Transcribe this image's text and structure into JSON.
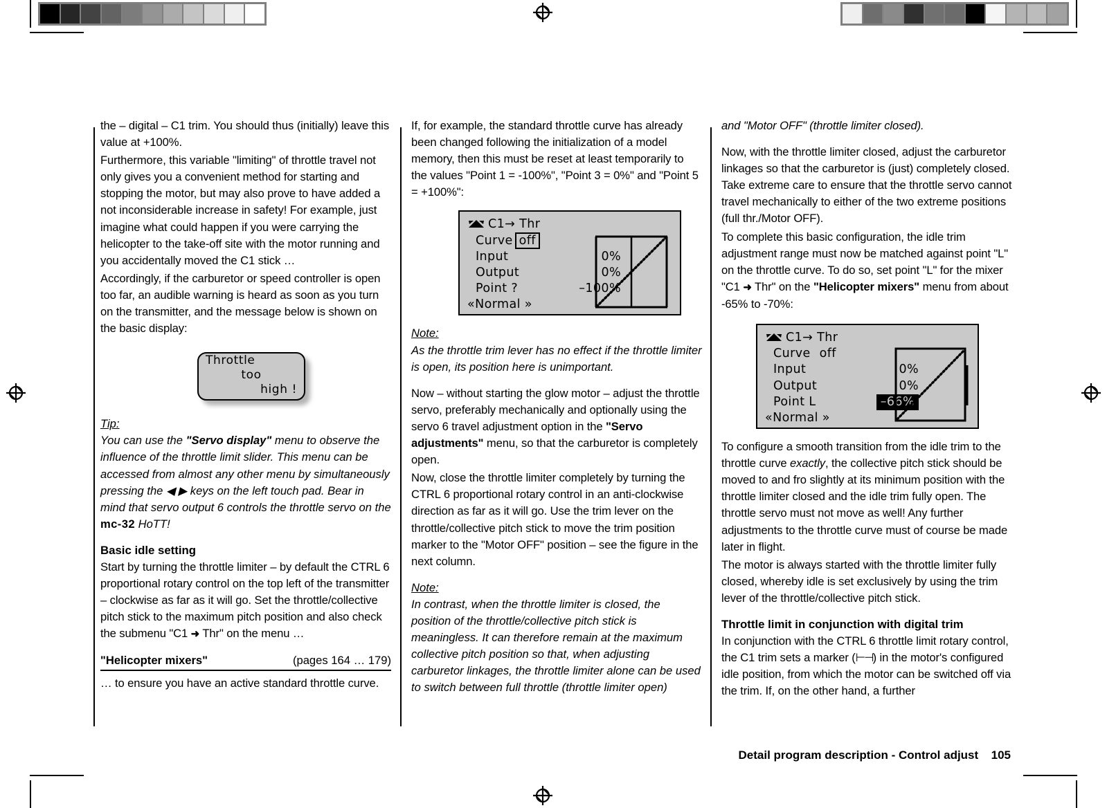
{
  "page": {
    "footer_text": "Detail program description - Control adjust",
    "page_number": "105"
  },
  "calibration": {
    "left_strip": [
      "#000000",
      "#262626",
      "#434343",
      "#636363",
      "#7c7c7c",
      "#949494",
      "#ababab",
      "#c4c4c4",
      "#dadada",
      "#efefef",
      "#ffffff"
    ],
    "right_strip": [
      "#efefef",
      "#6e6e6e",
      "#8a8a8a",
      "#303030",
      "#707070",
      "#6b6b6b",
      "#000000",
      "#f5f5f5",
      "#b4b4b4",
      "#bcbcbc",
      "#a2a2a2"
    ]
  },
  "column1": {
    "p1": "the – digital – C1 trim. You should thus (initially) leave this value at +100%.",
    "p2": "Furthermore, this variable \"limiting\" of throttle travel not only gives you a convenient method for starting and stopping the motor, but may also prove to have added a not inconsiderable increase in safety! For example, just imagine what could happen if you were carrying the helicopter to the take-off site with the motor running and you accidentally moved the C1 stick …",
    "p3": "Accordingly, if the carburetor or speed controller is open too far, an audible warning is heard as soon as you turn on the transmitter, and the message below is shown on the basic display:",
    "popup": {
      "line1": "Throttle",
      "line2": "too",
      "line3": "high !"
    },
    "tip": {
      "label": "Tip:",
      "part1": "You can use the ",
      "bold1": "\"Servo display\"",
      "part2": " menu to observe the influence of the throttle limit slider. This menu can be accessed from almost any other menu by simultaneously pressing the ",
      "keys": "◀ ▶",
      "part3": " keys on the left touch pad. Bear in mind that servo output 6 controls the throttle servo on the ",
      "bold2": "mc-32",
      "part4": " HoTT!"
    },
    "heading": "Basic idle setting",
    "p4_a": "Start by turning the throttle limiter – by default the CTRL 6 proportional rotary control on the top left of the transmitter – clockwise as far as it will go. Set the throttle/collective pitch stick to the maximum pitch position and also check the submenu \"C1 ",
    "p4_arrow": "➜",
    "p4_b": " Thr\" on the menu …",
    "xref_name": "\"Helicopter mixers\"",
    "xref_pages": "(pages 164 … 179)",
    "p5": "… to ensure you have an active standard throttle curve."
  },
  "column2": {
    "p1": "If, for example, the standard throttle curve has already been changed following the initialization of a model memory, then this must be reset at least temporarily to the values \"Point 1 = -100%\", \"Point 3 = 0%\" and \"Point 5 = +100%\":",
    "lcd": {
      "title": "C1→ Thr",
      "curve_label": "Curve",
      "curve_value": "off",
      "input_label": "Input",
      "input_value": "0%",
      "output_label": "Output",
      "output_value": "0%",
      "point_label": "Point  ?",
      "point_value": "–100%",
      "footer": "«Normal  »"
    },
    "note1": {
      "label": "Note:",
      "text": "As the throttle trim lever has no effect if the throttle limiter is open, its position here is unimportant."
    },
    "p2": "Now – without starting the glow motor – adjust the throttle servo, preferably mechanically and optionally using the servo 6 travel adjustment option in the ",
    "p2_bold": "\"Servo adjustments\"",
    "p2_b": " menu, so that the carburetor is completely open.",
    "p3": "Now, close the throttle limiter completely by turning the CTRL 6 proportional rotary control in an anti-clockwise direction as far as it will go. Use the trim lever on the throttle/collective pitch stick to move the trim position marker to the \"Motor OFF\" position – see the figure in the next column.",
    "note2": {
      "label": "Note:",
      "text": "In contrast, when the throttle limiter is closed, the position of the throttle/collective pitch stick is meaningless. It can therefore remain at the maximum collective pitch position so that, when adjusting carburetor linkages, the throttle limiter alone can be used to switch between full throttle (throttle limiter open)"
    }
  },
  "column3": {
    "note_cont": "and \"Motor OFF\" (throttle limiter closed).",
    "p1": "Now, with the throttle limiter closed, adjust the carburetor linkages so that the carburetor is (just) completely closed. Take extreme care to ensure that the throttle servo cannot travel mechanically to either of the two extreme positions (full thr./Motor OFF).",
    "p2_a": "To complete this basic configuration, the idle trim adjustment range must now be matched against point \"L\" on the throttle curve. To do so, set point \"L\" for the mixer \"C1 ",
    "p2_arrow": "➜",
    "p2_b": " Thr\" on the ",
    "p2_bold": "\"Helicopter mixers\"",
    "p2_c": " menu from about -65% to -70%:",
    "lcd": {
      "title": "C1→ Thr",
      "curve_label": "Curve",
      "curve_value": "off",
      "input_label": "Input",
      "input_value": "0%",
      "output_label": "Output",
      "output_value": "0%",
      "point_label": "Point   L",
      "point_value": "–66%",
      "footer": "«Normal  »"
    },
    "p3_a": "To configure a smooth transition from the idle trim to the throttle curve ",
    "p3_ital": "exactly",
    "p3_b": ", the collective pitch stick should be moved to and fro slightly at its minimum position with the throttle limiter closed and the idle trim fully open. The throttle servo must not move as well! Any further adjustments to the throttle curve must of course be made later in flight.",
    "p4": "The motor is always started with the throttle limiter fully closed, whereby idle is set exclusively by using the trim lever of the throttle/collective pitch stick.",
    "heading": "Throttle limit in conjunction with digital trim",
    "p5_a": "In conjunction with the CTRL 6 throttle limit rotary control, the C1 trim sets a marker (",
    "p5_marker": "⊢",
    "p5_b": ") in the motor's configured idle position, from which the motor can be switched off via the trim. If, on the other hand, a further"
  }
}
